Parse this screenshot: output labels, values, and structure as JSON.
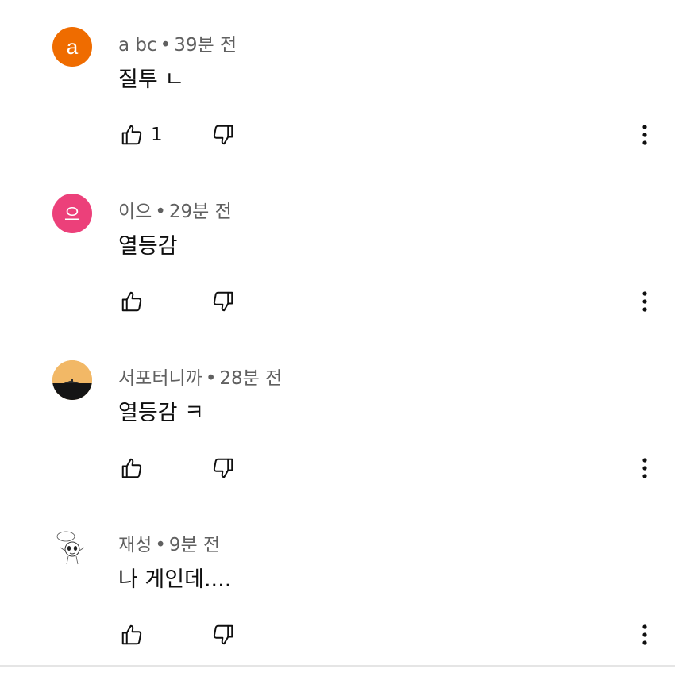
{
  "comments": [
    {
      "author": "a bc",
      "separator": "•",
      "time": "39분 전",
      "text": "질투 ㄴ",
      "like_count": "1",
      "avatar": {
        "type": "letter",
        "letter": "a",
        "color": "#ef6c00"
      }
    },
    {
      "author": "이으",
      "separator": "•",
      "time": "29분 전",
      "text": "열등감",
      "like_count": "",
      "avatar": {
        "type": "letter",
        "letter": "으",
        "color": "#ec407a"
      }
    },
    {
      "author": "서포터니까",
      "separator": "•",
      "time": "28분 전",
      "text": "열등감 ㅋ",
      "like_count": "",
      "avatar": {
        "type": "image",
        "icon": "sunset-photo-icon",
        "colors": [
          "#f2b866",
          "#1a1a1a"
        ]
      }
    },
    {
      "author": "재성",
      "separator": "•",
      "time": "9분 전",
      "text": "나 게인데....",
      "like_count": "",
      "avatar": {
        "type": "image",
        "icon": "cartoon-sketch-icon",
        "colors": [
          "#ffffff",
          "#333333"
        ]
      }
    }
  ],
  "icons": {
    "like": "thumbs-up-icon",
    "dislike": "thumbs-down-icon",
    "more": "more-vertical-icon"
  }
}
